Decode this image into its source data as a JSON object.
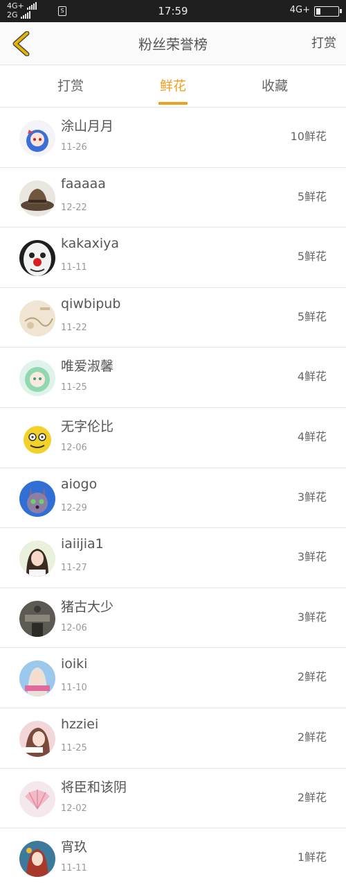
{
  "status_bar": {
    "net1": "4G+",
    "net2": "2G",
    "sim_icon": "S",
    "time": "17:59",
    "net_right": "4G+"
  },
  "header": {
    "title": "粉丝荣誉榜",
    "action": "打赏"
  },
  "tabs": [
    {
      "label": "打赏",
      "active": false
    },
    {
      "label": "鲜花",
      "active": true
    },
    {
      "label": "收藏",
      "active": false
    }
  ],
  "colors": {
    "accent": "#f0a020",
    "back_arrow": "#e6b500",
    "text": "#555555",
    "subtext": "#999999",
    "divider": "#e6e6e6"
  },
  "fans": [
    {
      "name": "涂山月月",
      "date": "11-26",
      "amount": "10鲜花",
      "avatar": "anime-girl-blue-hair"
    },
    {
      "name": "faaaaa",
      "date": "12-22",
      "amount": "5鲜花",
      "avatar": "brown-hat"
    },
    {
      "name": "kakaxiya",
      "date": "11-11",
      "amount": "5鲜花",
      "avatar": "clown-face"
    },
    {
      "name": "qiwbipub",
      "date": "11-22",
      "amount": "5鲜花",
      "avatar": "beige-sketch"
    },
    {
      "name": "唯爱淑馨",
      "date": "11-25",
      "amount": "4鲜花",
      "avatar": "anime-girl-green-hair"
    },
    {
      "name": "无字伦比",
      "date": "12-06",
      "amount": "4鲜花",
      "avatar": "yellow-meme-face"
    },
    {
      "name": "aiogo",
      "date": "12-29",
      "amount": "3鲜花",
      "avatar": "cartoon-rabbit"
    },
    {
      "name": "iaiijia1",
      "date": "11-27",
      "amount": "3鲜花",
      "avatar": "girl-photo"
    },
    {
      "name": "猪古大少",
      "date": "12-06",
      "amount": "3鲜花",
      "avatar": "dark-photo"
    },
    {
      "name": "ioiki",
      "date": "11-10",
      "amount": "2鲜花",
      "avatar": "girl-blue-photo"
    },
    {
      "name": "hzziei",
      "date": "11-25",
      "amount": "2鲜花",
      "avatar": "girl-pink-photo"
    },
    {
      "name": "将臣和该阴",
      "date": "12-02",
      "amount": "2鲜花",
      "avatar": "pink-shell"
    },
    {
      "name": "宵玖",
      "date": "11-11",
      "amount": "1鲜花",
      "avatar": "anime-girl-red"
    }
  ]
}
